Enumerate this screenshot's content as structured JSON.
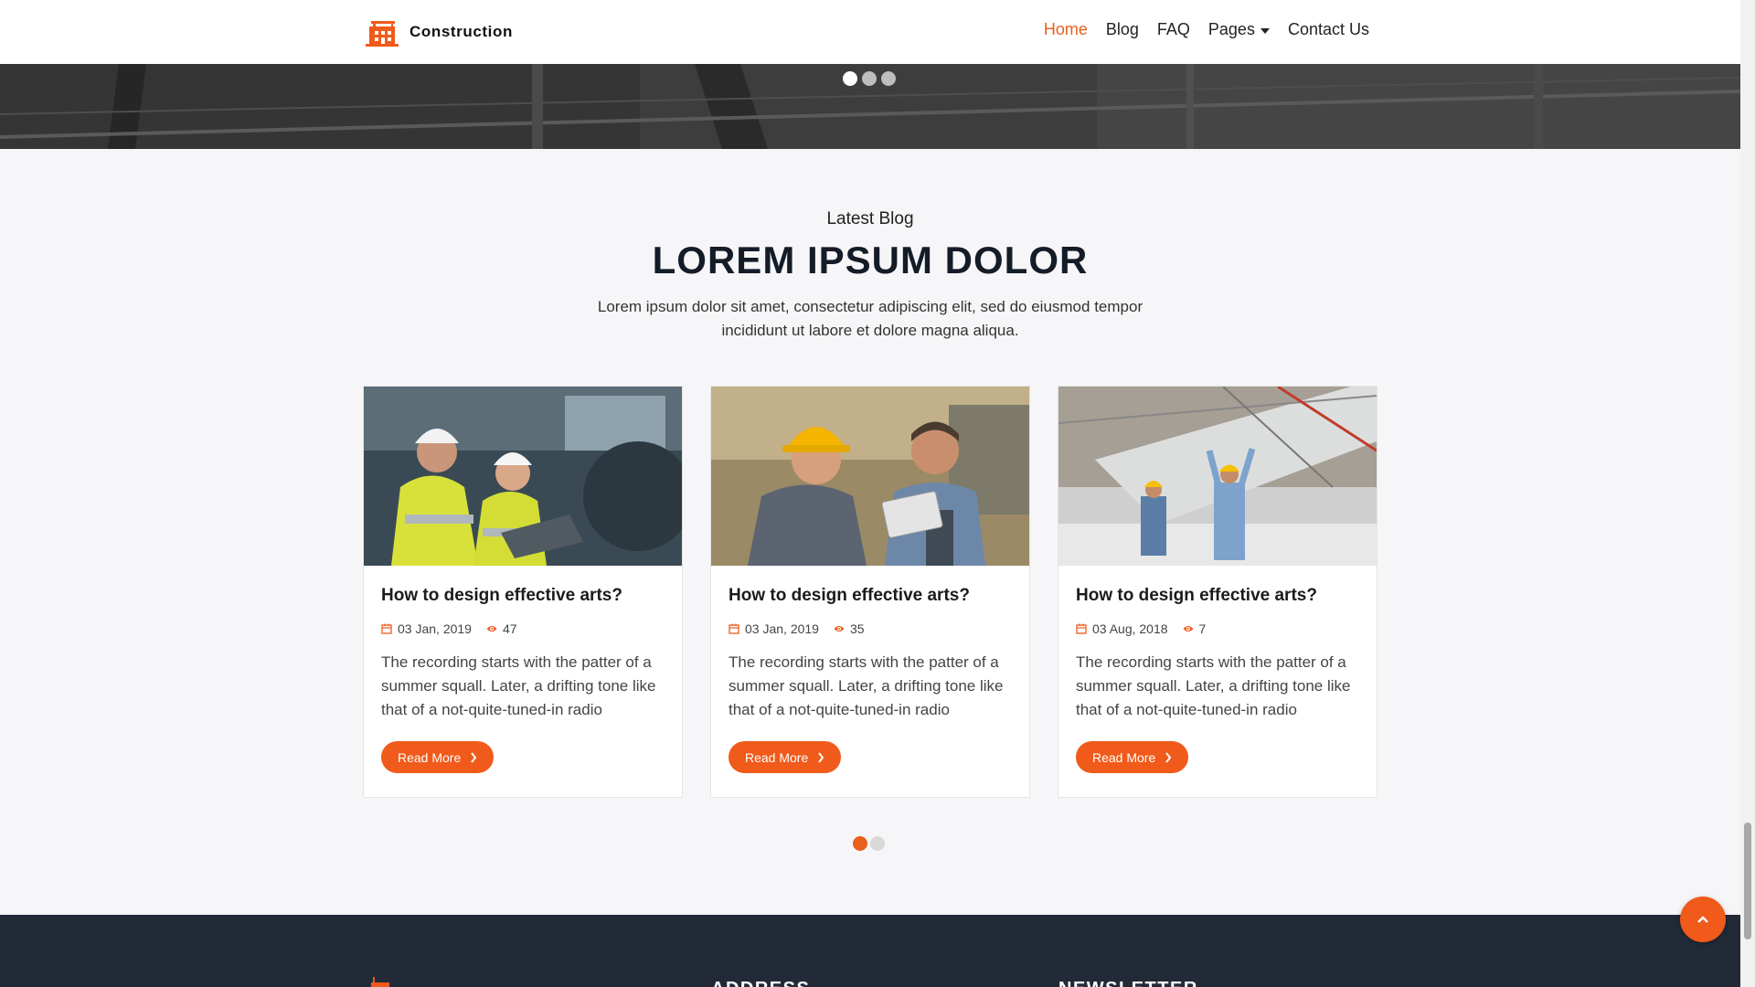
{
  "brand": {
    "name": "Construction",
    "logo_icon": "crane-building-icon"
  },
  "nav": {
    "items": [
      {
        "label": "Home",
        "active": true
      },
      {
        "label": "Blog",
        "active": false
      },
      {
        "label": "FAQ",
        "active": false
      },
      {
        "label": "Pages",
        "active": false,
        "dropdown": true
      },
      {
        "label": "Contact Us",
        "active": false
      }
    ]
  },
  "hero": {
    "slide_count": 3,
    "active_slide": 1
  },
  "blog": {
    "subtitle": "Latest Blog",
    "title": "LOREM IPSUM DOLOR",
    "intro": "Lorem ipsum dolor sit amet, consectetur adipiscing elit, sed do eiusmod tempor incididunt ut labore et dolore magna aliqua.",
    "posts": [
      {
        "title": "How to design effective arts?",
        "date": "03 Jan, 2019",
        "views": "47",
        "excerpt": "The recording starts with the patter of a summer squall. Later, a drifting tone like that of a not-quite-tuned-in radio",
        "button": "Read More"
      },
      {
        "title": "How to design effective arts?",
        "date": "03 Jan, 2019",
        "views": "35",
        "excerpt": "The recording starts with the patter of a summer squall. Later, a drifting tone like that of a not-quite-tuned-in radio",
        "button": "Read More"
      },
      {
        "title": "How to design effective arts?",
        "date": "03 Aug, 2018",
        "views": "7",
        "excerpt": "The recording starts with the patter of a summer squall. Later, a drifting tone like that of a not-quite-tuned-in radio",
        "button": "Read More"
      }
    ],
    "page_count": 2,
    "active_page": 1
  },
  "footer": {
    "headings": [
      "ADDRESS",
      "NEWSLETTER"
    ]
  },
  "colors": {
    "accent": "#f05a1a",
    "nav_active": "#e8611c",
    "footer_bg": "#222a38",
    "title": "#141c28"
  },
  "icons": {
    "date": "calendar-icon",
    "views": "eye-icon",
    "read_more": "chevron-right-icon",
    "scroll_top": "chevron-up-icon"
  }
}
